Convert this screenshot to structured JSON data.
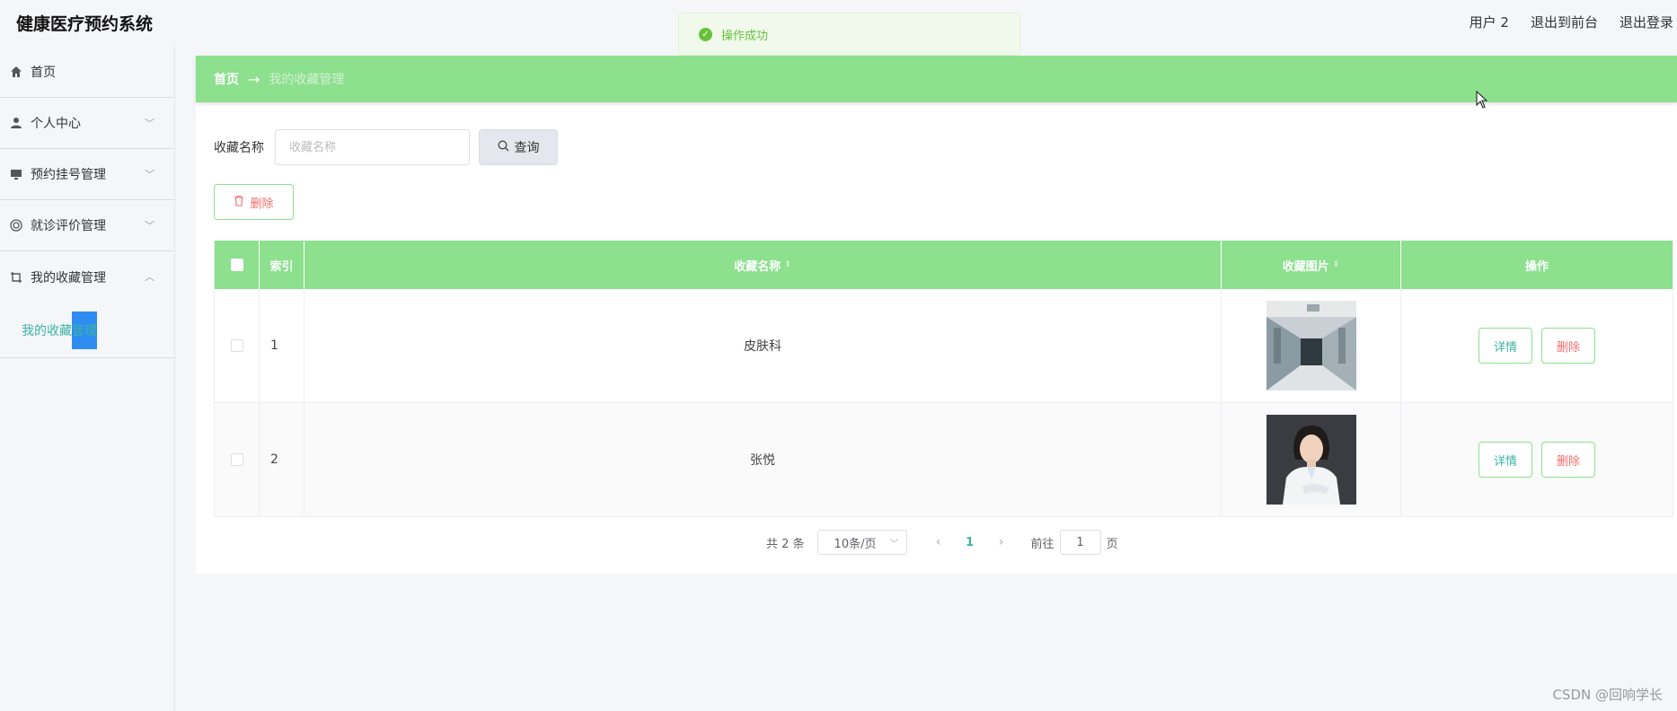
{
  "header": {
    "title": "健康医疗预约系统",
    "user": "用户 2",
    "exit_front": "退出到前台",
    "logout": "退出登录"
  },
  "toast": {
    "message": "操作成功",
    "icon": "check-circle-icon"
  },
  "sidebar": {
    "items": [
      {
        "label": "首页",
        "icon": "home-icon"
      },
      {
        "label": "个人中心",
        "icon": "user-icon",
        "expanded": false
      },
      {
        "label": "预约挂号管理",
        "icon": "monitor-icon",
        "expanded": false
      },
      {
        "label": "就诊评价管理",
        "icon": "circle-icon",
        "expanded": false
      },
      {
        "label": "我的收藏管理",
        "icon": "crop-icon",
        "expanded": true
      }
    ],
    "submenu": [
      {
        "label": "我的收藏管理"
      }
    ]
  },
  "breadcrumb": {
    "home": "首页",
    "arrow": "→",
    "current": "我的收藏管理"
  },
  "search": {
    "label": "收藏名称",
    "placeholder": "收藏名称",
    "value": "",
    "button_label": "查询"
  },
  "toolbar": {
    "delete_label": "删除"
  },
  "table": {
    "columns": [
      "索引",
      "收藏名称",
      "收藏图片",
      "操作"
    ],
    "rows": [
      {
        "index": "1",
        "name": "皮肤科",
        "image": "hospital-corridor-photo",
        "detail_label": "详情",
        "delete_label": "删除"
      },
      {
        "index": "2",
        "name": "张悦",
        "image": "doctor-portrait-photo",
        "detail_label": "详情",
        "delete_label": "删除"
      }
    ]
  },
  "pagination": {
    "total": "共 2 条",
    "page_size": "10条/页",
    "current_page": "1",
    "goto_label": "前往",
    "goto_value": "1",
    "page_suffix": "页"
  },
  "watermark": "CSDN @回响学长",
  "colors": {
    "accent_green": "#8ce08e",
    "teal_text": "#3bb4a4",
    "danger": "#f56c6c",
    "toast_green": "#67c23a",
    "highlight_blue": "#2e8cf0"
  }
}
